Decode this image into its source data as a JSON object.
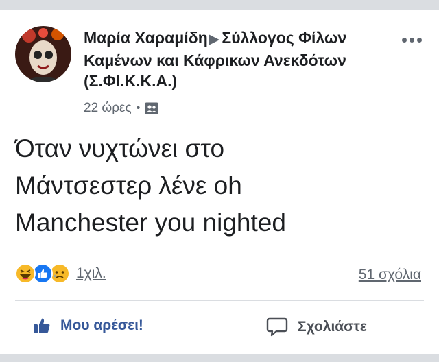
{
  "post": {
    "author": "Μαρία Χαραμίδη",
    "group": "Σύλλογος Φίλων Καμένων και Κάφρικων Ανεκδότων (Σ.ΦΙ.Κ.Κ.Α.)",
    "time": "22 ώρες",
    "privacy_icon": "group-members-icon",
    "text_lines": [
      "Όταν νυχτώνει στο",
      "Μάντσεστερ λένε oh",
      "Manchester you nighted"
    ]
  },
  "engagement": {
    "reactions": [
      "haha",
      "like",
      "sad"
    ],
    "reaction_count": "1χιλ.",
    "comment_count": "51 σχόλια"
  },
  "actions": {
    "like_label": "Μου αρέσει!",
    "comment_label": "Σχολιάστε"
  },
  "colors": {
    "like_blue": "#365899",
    "reaction_yellow": "#f7b928",
    "band_gray": "#dadde1"
  }
}
